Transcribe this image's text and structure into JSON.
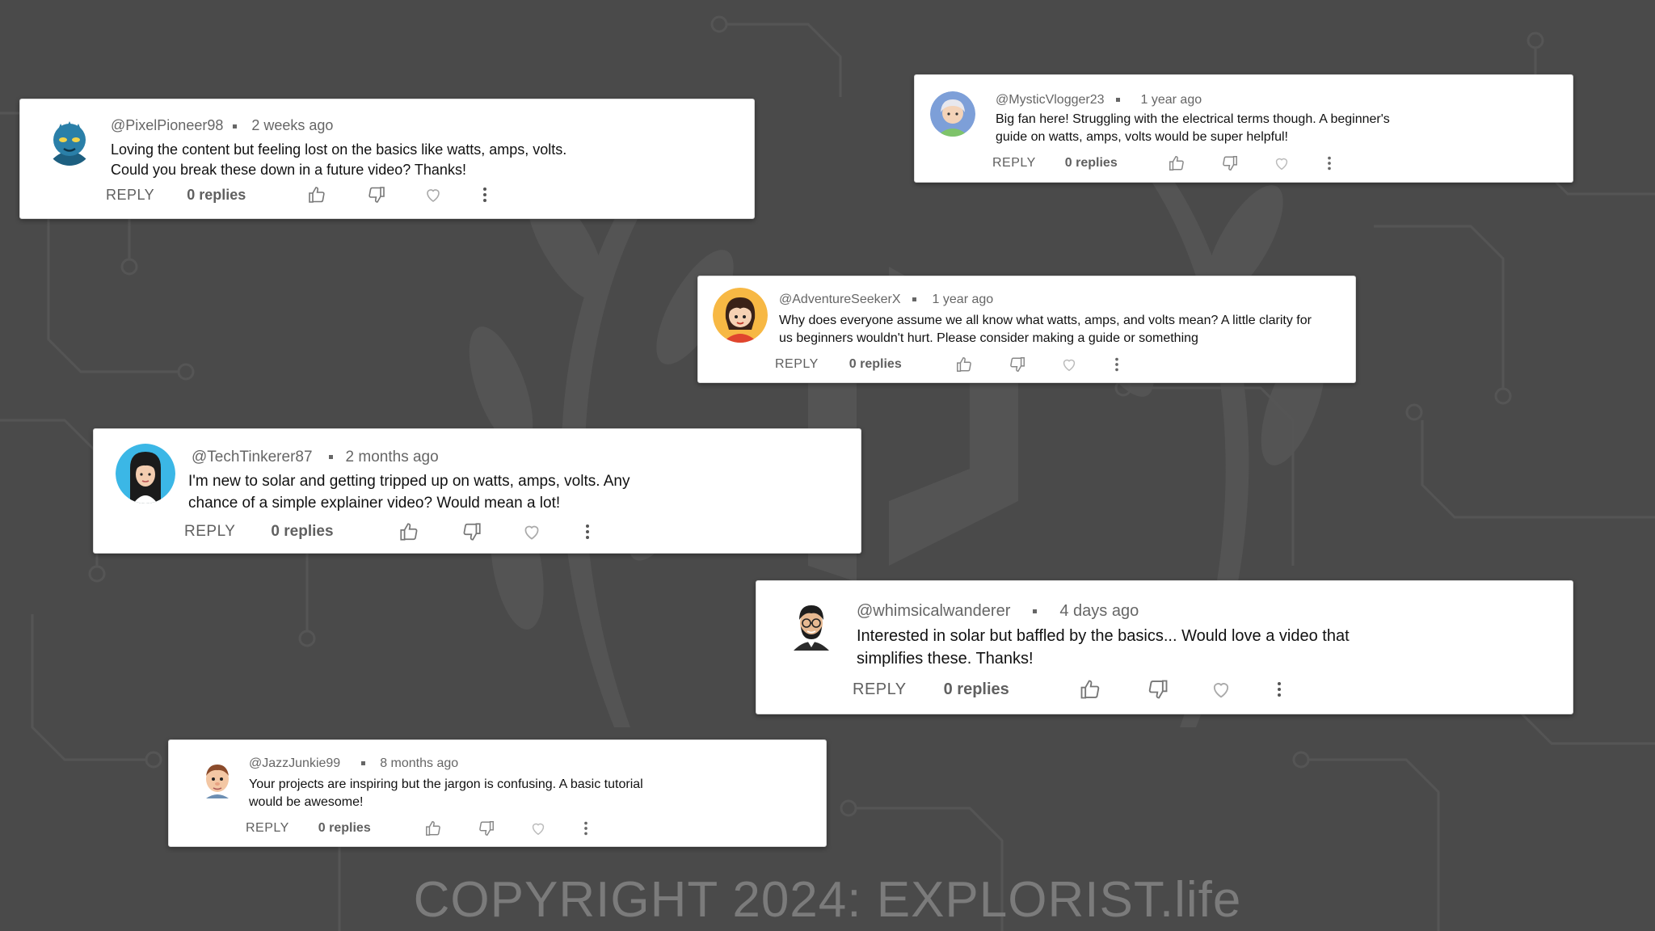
{
  "comments": [
    {
      "handle": "@PixelPioneer98",
      "ago": "2 weeks ago",
      "line1": "Loving the content but feeling lost on the basics like watts, amps, volts.",
      "line2": "Could you break these down in a future video? Thanks!",
      "reply_label": "REPLY",
      "replies_label": "0 replies"
    },
    {
      "handle": "@MysticVlogger23",
      "ago": "1 year ago",
      "line1": "Big fan here! Struggling with the electrical terms though. A beginner's",
      "line2": "guide on watts, amps, volts would be super helpful!",
      "reply_label": "REPLY",
      "replies_label": "0 replies"
    },
    {
      "handle": "@AdventureSeekerX",
      "ago": "1 year ago",
      "line1": "Why does everyone assume we all know what watts, amps, and volts mean? A little clarity for",
      "line2": "us beginners wouldn't hurt. Please consider making a guide or something",
      "reply_label": "REPLY",
      "replies_label": "0 replies"
    },
    {
      "handle": "@TechTinkerer87",
      "ago": "2 months ago",
      "line1": "I'm new to solar and getting tripped up on watts, amps, volts. Any",
      "line2": "chance of a simple explainer video? Would mean a lot!",
      "reply_label": "REPLY",
      "replies_label": "0 replies"
    },
    {
      "handle": "@whimsicalwanderer",
      "ago": "4 days ago",
      "line1": "Interested in solar but baffled by the basics... Would love a video that",
      "line2": "simplifies these. Thanks!",
      "reply_label": "REPLY",
      "replies_label": "0 replies"
    },
    {
      "handle": "@JazzJunkie99",
      "ago": "8 months ago",
      "line1": "Your projects are inspiring but the jargon is confusing. A basic tutorial",
      "line2": "would be awesome!",
      "reply_label": "REPLY",
      "replies_label": "0 replies"
    }
  ],
  "footer": {
    "copyright": "COPYRIGHT 2024: EXPLORIST.life"
  },
  "icons": [
    "thumbs-up-icon",
    "thumbs-down-icon",
    "heart-icon",
    "more-vert-icon"
  ],
  "colors": {
    "background": "#4a4a4a",
    "card": "#ffffff",
    "muted_text": "#606060",
    "watermark": "#7b7b7b"
  }
}
